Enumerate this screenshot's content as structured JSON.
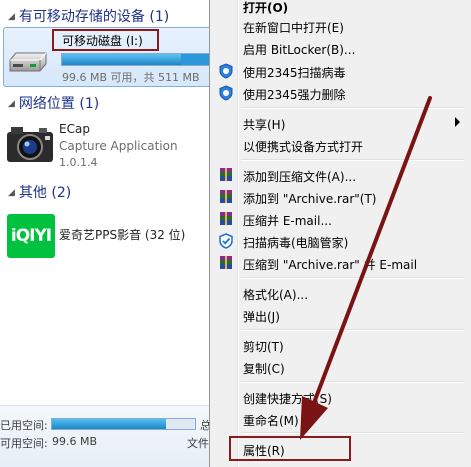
{
  "explorer": {
    "groups": [
      {
        "title": "有可移动存储的设备 (1)"
      },
      {
        "title": "网络位置 (1)"
      },
      {
        "title": "其他 (2)"
      }
    ],
    "removable_drive": {
      "name": "可移动磁盘 (I:)",
      "stats": "99.6 MB 可用，共 511 MB",
      "used_fraction": 0.8,
      "icon": "usb-drive-icon"
    },
    "ecap": {
      "name": "ECap",
      "description": "Capture Application",
      "version": "1.0.1.4",
      "icon": "camera-icon"
    },
    "iqiyi": {
      "name": "爱奇艺PPS影音 (32 位)",
      "logo_text": "iQIYI",
      "icon": "iqiyi-logo-icon"
    },
    "details": {
      "used_label": "已用空间:",
      "free_label": "可用空间:",
      "free_value": "99.6 MB",
      "total_label_fragment": "总",
      "fs_label_fragment": "文件",
      "used_fraction": 0.8
    }
  },
  "context_menu": {
    "items": [
      {
        "label": "打开(O)",
        "bold": true
      },
      {
        "label": "在新窗口中打开(E)"
      },
      {
        "label": "启用 BitLocker(B)..."
      },
      {
        "label": "使用2345扫描病毒",
        "icon": "shield-2345-icon"
      },
      {
        "label": "使用2345强力删除",
        "icon": "shield-2345-icon"
      },
      {
        "label": "共享(H)",
        "submenu": true
      },
      {
        "label": "以便携式设备方式打开"
      },
      {
        "label": "添加到压缩文件(A)...",
        "icon": "winrar-icon"
      },
      {
        "label": "添加到 \"Archive.rar\"(T)",
        "icon": "winrar-icon"
      },
      {
        "label": "压缩并 E-mail...",
        "icon": "winrar-icon"
      },
      {
        "label": "扫描病毒(电脑管家)",
        "icon": "pc-manager-icon"
      },
      {
        "label": "压缩到 \"Archive.rar\" 并 E-mail",
        "icon": "winrar-icon"
      },
      {
        "label": "格式化(A)..."
      },
      {
        "label": "弹出(J)"
      },
      {
        "label": "剪切(T)"
      },
      {
        "label": "复制(C)"
      },
      {
        "label": "创建快捷方式(S)"
      },
      {
        "label": "重命名(M)"
      },
      {
        "label": "属性(R)"
      }
    ]
  },
  "colors": {
    "annotation": "#8b1a1a",
    "group_title": "#1e3287",
    "menu_bg": "#f0f0f0"
  }
}
